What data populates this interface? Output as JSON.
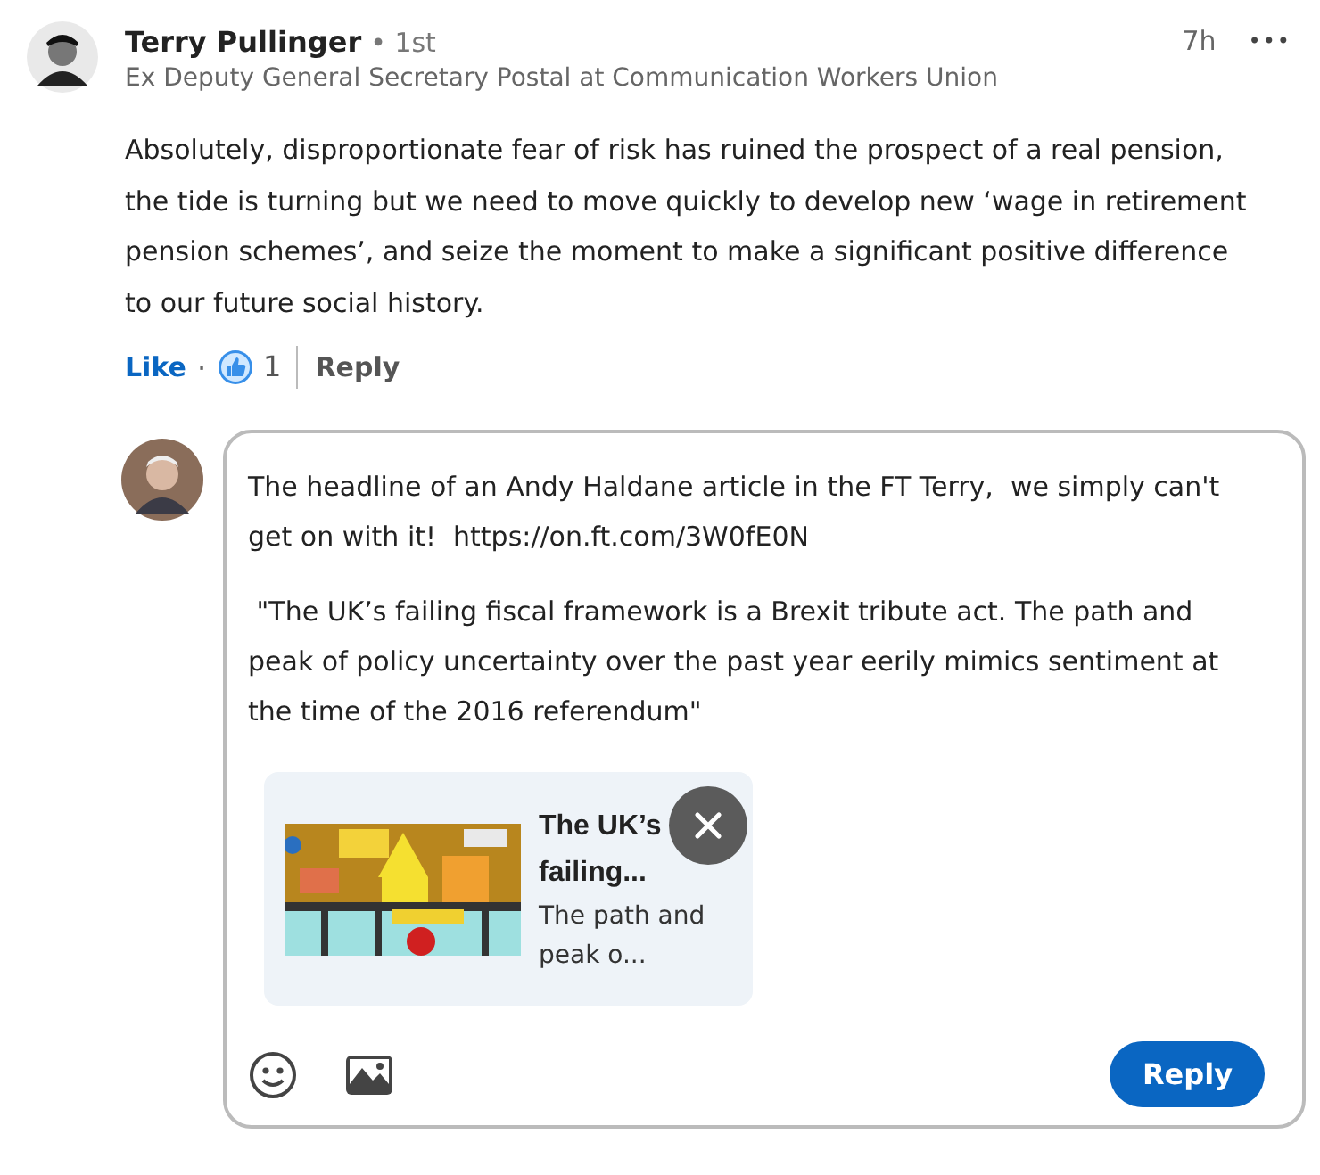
{
  "comment": {
    "author": "Terry Pullinger",
    "degree": "• 1st",
    "headline": "Ex Deputy General Secretary Postal at Communication Workers Union",
    "time": "7h",
    "menu": "•••",
    "text": "Absolutely, disproportionate fear of risk has ruined the prospect of a real pension, the tide is turning but we need to move quickly to develop new ‘wage in retirement pension schemes’, and seize the moment to make a significant positive difference to our future social history.",
    "like": "Like",
    "separator": "·",
    "reaction_count": "1",
    "reply": "Reply"
  },
  "composer": {
    "paragraphs": [
      "The headline of an Andy Haldane article in the FT Terry,  we simply can't get on with it!  https://on.ft.com/3W0fE0N",
      " \"The UK’s failing fiscal framework is a Brexit tribute act. The path and peak of policy uncertainty over the past year eerily mimics sentiment at the time of the 2016 referendum\""
    ],
    "preview": {
      "title": "The UK’s failing...",
      "description": "The path and peak o..."
    },
    "submit": "Reply"
  }
}
